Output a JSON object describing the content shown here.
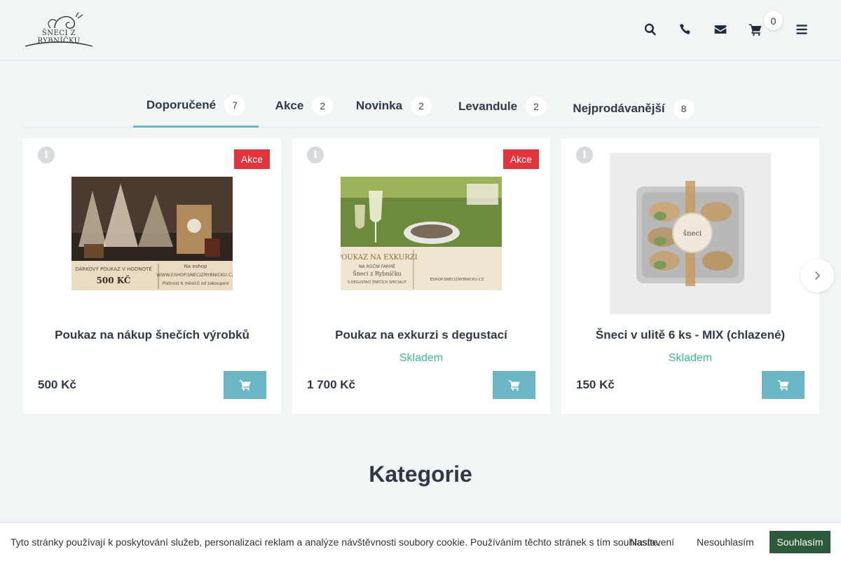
{
  "header": {
    "logo_text": "ŠNECI Z RYBNÍČKU",
    "icons": [
      "search-icon",
      "phone-icon",
      "envelope-icon",
      "cart-icon",
      "hamburger-menu-icon"
    ],
    "cart_count": "0"
  },
  "tabs": [
    {
      "label": "Doporučené",
      "count": "7",
      "active": true
    },
    {
      "label": "Akce",
      "count": "2",
      "active": false
    },
    {
      "label": "Novinka",
      "count": "2",
      "active": false
    },
    {
      "label": "Levandule",
      "count": "2",
      "active": false
    },
    {
      "label": "Nejprodávanější",
      "count": "8",
      "active": false
    }
  ],
  "products": [
    {
      "name": "Poukaz na nákup šnečích výrobků",
      "badge": "Akce",
      "stock": "",
      "price": "500 Kč",
      "image_text": [
        "DÁRKOVÝ POUKAZ V HODNOTĚ",
        "500 KČ",
        "Na eshop",
        "WWW.ESHOP.SNECIZRYBNICKU.CZ",
        "Platnost 6 měsíců od zakoupení"
      ]
    },
    {
      "name": "Poukaz na exkurzi s degustací",
      "badge": "Akce",
      "stock": "Skladem",
      "price": "1 700 Kč",
      "image_text": [
        "POUKAZ NA EXKURZI",
        "NA ROČNÍ FARMĚ",
        "Šneci z Rybníčku",
        "S DEGUSTACÍ ŠNEČÍCH SPECIALIT",
        "ESHOP.SNECIZRYBNICKU.CZ"
      ]
    },
    {
      "name": "Šneci v ulitě 6 ks - MIX (chlazené)",
      "badge": "",
      "stock": "Skladem",
      "price": "150 Kč",
      "image_text": [
        "šneci"
      ]
    }
  ],
  "section_title": "Kategorie",
  "cookie": {
    "text": "Tyto stránky používají k poskytování služeb, personalizaci reklam a analýze návštěvnosti soubory cookie. Používáním těchto stránek s tím souhlasíte.",
    "settings": "Nastavení",
    "decline": "Nesouhlasím",
    "accept": "Souhlasím"
  },
  "colors": {
    "accent": "#6ab6c5",
    "badge_red": "#e0333c",
    "stock_green": "#3bb98b",
    "accept_green": "#2d5a3b",
    "page_bg": "#f1f5f6"
  }
}
